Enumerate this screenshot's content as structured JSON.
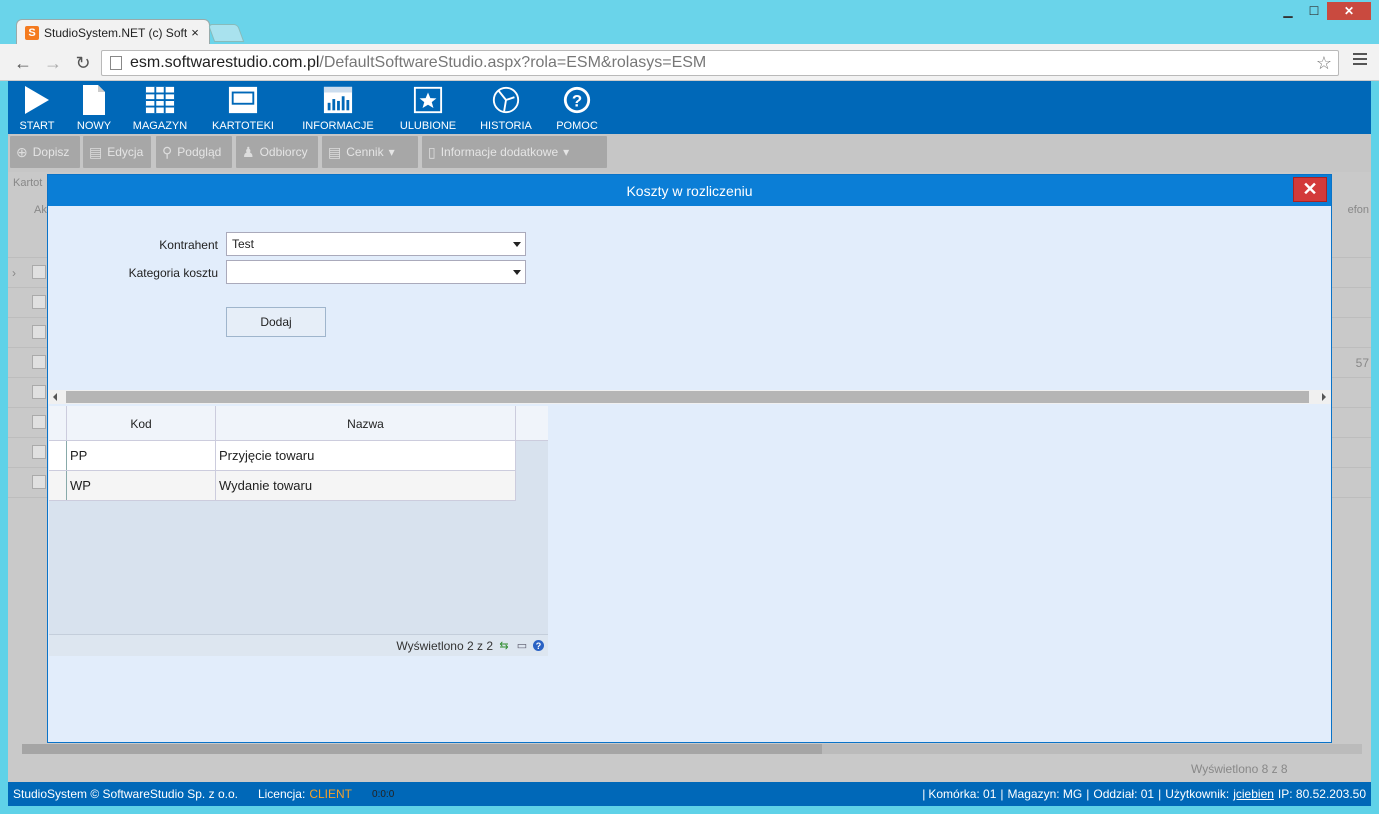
{
  "browser": {
    "tab_title": "StudioSystem.NET (c) Soft",
    "tab_close": "×",
    "url_host": "esm.softwarestudio.com.pl",
    "url_path": "/DefaultSoftwareStudio.aspx?rola=ESM&rolasys=ESM"
  },
  "nav": {
    "items": [
      {
        "label": "START",
        "icon": "play-icon"
      },
      {
        "label": "NOWY",
        "icon": "document-icon"
      },
      {
        "label": "MAGAZYN",
        "icon": "grid-icon"
      },
      {
        "label": "KARTOTEKI",
        "icon": "monitor-icon"
      },
      {
        "label": "INFORMACJE",
        "icon": "chart-icon"
      },
      {
        "label": "ULUBIONE",
        "icon": "star-icon"
      },
      {
        "label": "HISTORIA",
        "icon": "history-icon"
      },
      {
        "label": "POMOC",
        "icon": "help-icon"
      }
    ]
  },
  "tools": {
    "dopisz": "Dopisz",
    "edycja": "Edycja",
    "podglad": "Podgląd",
    "odbiorcy": "Odbiorcy",
    "cennik": "Cennik",
    "info": "Informacje dodatkowe"
  },
  "background": {
    "caption": "Kartot",
    "col_ak": "Ak",
    "col_tel": "efon",
    "cell_57": "57",
    "footer": "Wyświetlono 8 z 8"
  },
  "modal": {
    "title": "Koszty w rozliczeniu",
    "close": "✕",
    "contractor_label": "Kontrahent",
    "contractor_value": "Test",
    "category_label": "Kategoria kosztu",
    "category_value": "",
    "add_button": "Dodaj",
    "grid": {
      "headers": [
        "Kod",
        "Nazwa"
      ],
      "rows": [
        {
          "kod": "PP",
          "nazwa": "Przyjęcie towaru"
        },
        {
          "kod": "WP",
          "nazwa": "Wydanie towaru"
        }
      ],
      "footer": "Wyświetlono 2 z 2"
    }
  },
  "status": {
    "copyright": "StudioSystem © SoftwareStudio Sp. z o.o.",
    "license_label": "Licencja:",
    "license_value": "CLIENT",
    "time": "0:0:0",
    "cell": "Komórka: 01",
    "warehouse": "Magazyn: MG",
    "branch": "Oddział: 01",
    "user_label": "Użytkownik:",
    "user": "jciebien",
    "ip": "IP: 80.52.203.50"
  }
}
